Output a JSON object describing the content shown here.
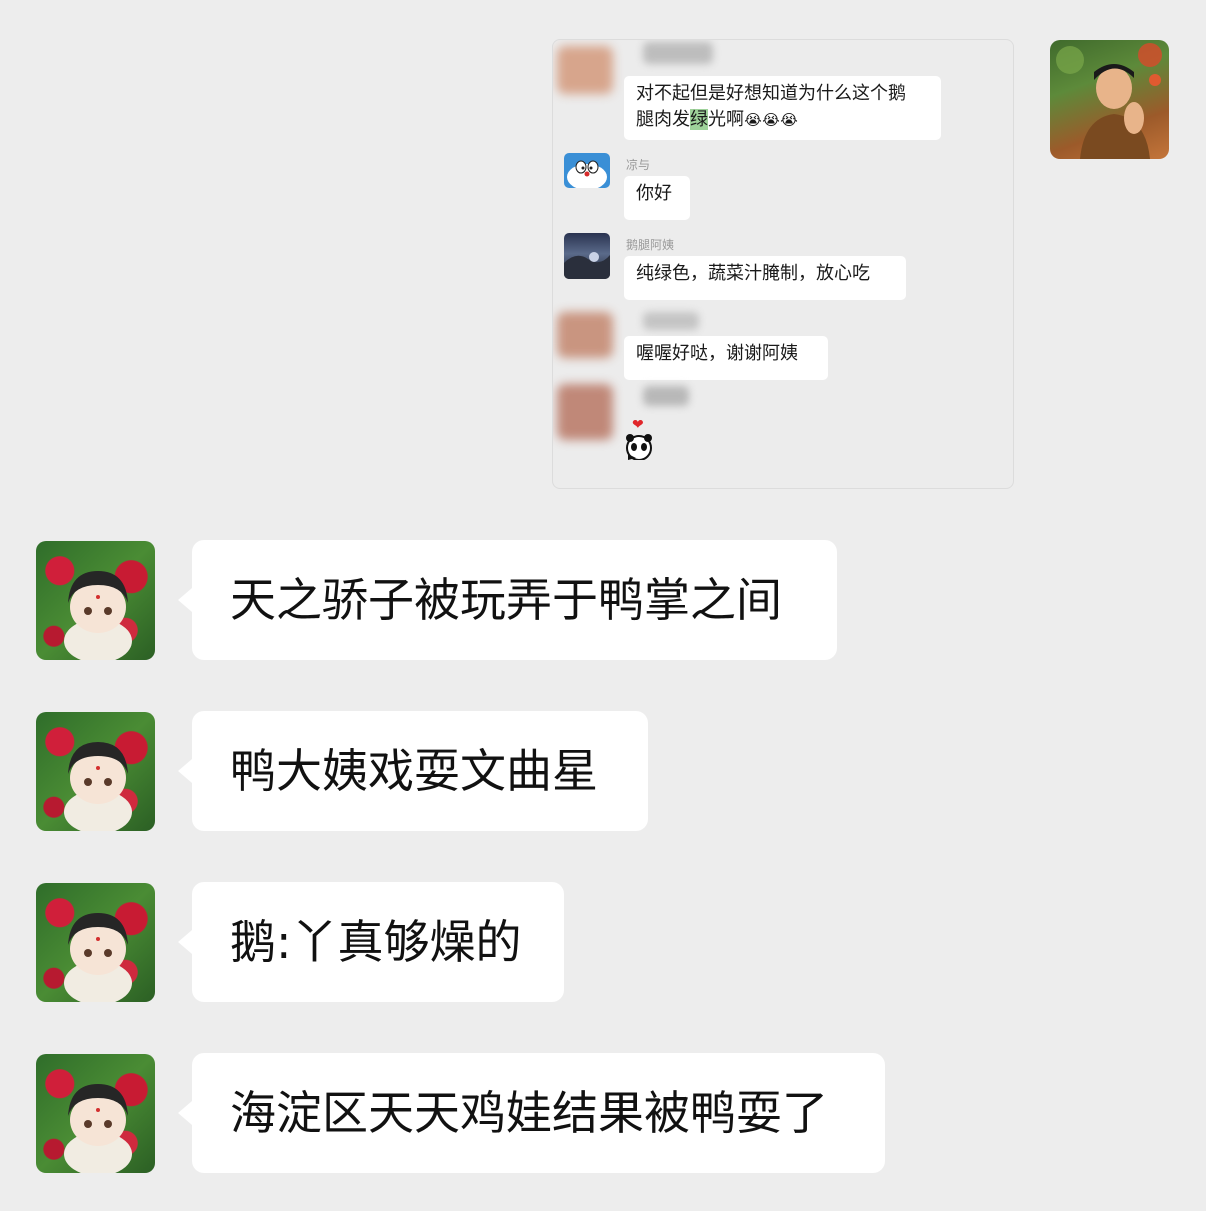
{
  "screenshot_message": {
    "messages": [
      {
        "id": "m1",
        "name": "",
        "text_before": "对不起但是好想知道为什么这个鹅",
        "line2_before": "腿肉发",
        "highlight": "绿",
        "line2_after": "光啊",
        "emojis": [
          "😭",
          "😭",
          "😭"
        ]
      },
      {
        "id": "m2",
        "name": "凉与",
        "text": "你好"
      },
      {
        "id": "m3",
        "name": "鹅腿阿姨",
        "text": "纯绿色，蔬菜汁腌制，放心吃"
      },
      {
        "id": "m4",
        "name": "",
        "text": "喔喔好哒，谢谢阿姨"
      },
      {
        "id": "m5",
        "name": "",
        "sticker": "❤"
      }
    ]
  },
  "messages": [
    {
      "text": "天之骄子被玩弄于鸭掌之间"
    },
    {
      "text": "鸭大姨戏耍文曲星"
    },
    {
      "text": "鹅:丫真够燥的"
    },
    {
      "text": "海淀区天天鸡娃结果被鸭耍了"
    }
  ],
  "colors": {
    "background": "#ededed",
    "bubble": "#ffffff",
    "highlight": "#9ed29a"
  }
}
